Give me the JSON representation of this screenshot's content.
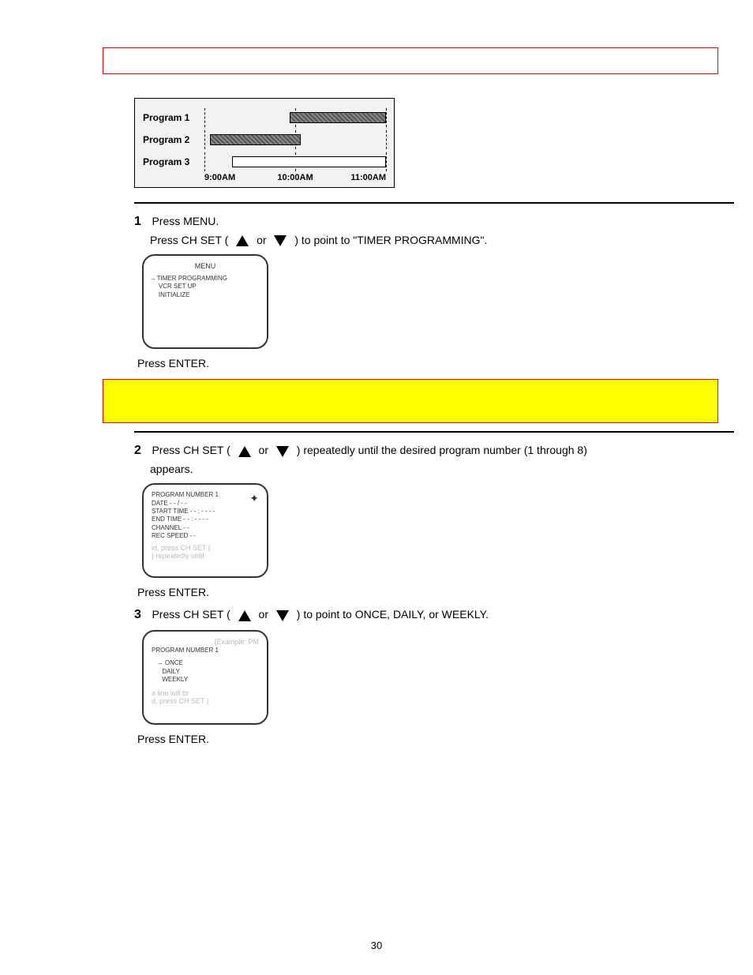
{
  "timeline": {
    "rows": [
      "Program 1",
      "Program 2",
      "Program 3"
    ],
    "times": [
      "9:00AM",
      "10:00AM",
      "11:00AM"
    ]
  },
  "step1": {
    "num": "1",
    "main": "Press MENU.",
    "line2a": "Press CH SET (",
    "line2b": ") to point to \"TIMER PROGRAMMING\".",
    "after": "Press ENTER."
  },
  "osd_menu": {
    "title": "MENU",
    "item1": "TIMER PROGRAMMING",
    "item2": "VCR SET UP",
    "item3": "INITIALIZE"
  },
  "step2": {
    "num": "2",
    "line1a": "Press CH SET (",
    "line1b": ") repeatedly until the desired program number (1 through 8)",
    "line2": "appears.",
    "after": "Press ENTER."
  },
  "osd_prog": {
    "l1": "PROGRAM NUMBER  1",
    "l2": "DATE            - - / - -",
    "l3": "START  TIME   - - : - -  - -",
    "l4": "END    TIME   - - : - -  - -",
    "l5": "CHANNEL        - -",
    "l6": "REC SPEED    - -"
  },
  "step3": {
    "num": "3",
    "line1a": "Press CH SET (",
    "line1b": ") to point to ONCE, DAILY, or WEEKLY.",
    "after": "Press ENTER."
  },
  "osd_freq": {
    "l1": "PROGRAM NUMBER   1",
    "opt1": "ONCE",
    "opt2": "DAILY",
    "opt3": "WEEKLY"
  },
  "page_number": "30"
}
